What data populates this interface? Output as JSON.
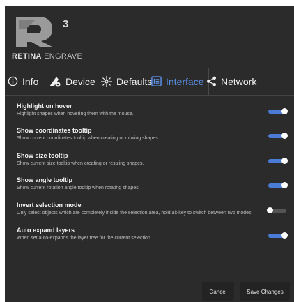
{
  "logo": {
    "superscript": "3",
    "brand_bold": "RETINA",
    "brand_light": "ENGRAVE"
  },
  "tabs": [
    {
      "label": "Info",
      "icon": "info-icon",
      "active": false
    },
    {
      "label": "Device",
      "icon": "device-icon",
      "active": false
    },
    {
      "label": "Defaults",
      "icon": "defaults-icon",
      "active": false
    },
    {
      "label": "Interface",
      "icon": "interface-icon",
      "active": true
    },
    {
      "label": "Network",
      "icon": "share-icon",
      "active": false
    }
  ],
  "settings": [
    {
      "title": "Highlight on hover",
      "description": "Highlight shapes when hovering them with the mouse.",
      "enabled": true
    },
    {
      "title": "Show coordinates tooltip",
      "description": "Show current coordinates tooltip when creating or moving shapes.",
      "enabled": true
    },
    {
      "title": "Show size tooltip",
      "description": "Show current size tooltip when creating or resizing shapes.",
      "enabled": true
    },
    {
      "title": "Show angle tooltip",
      "description": "Show current rotation angle tooltip when rotating shapes.",
      "enabled": true
    },
    {
      "title": "Invert selection mode",
      "description": "Only select objects which are completely inside the selection area, hold alt-key to switch between two modes.",
      "enabled": false
    },
    {
      "title": "Auto expand layers",
      "description": "When set auto-expands the layer tree for the current selection.",
      "enabled": true
    }
  ],
  "buttons": {
    "cancel": "Cancel",
    "save": "Save Changes"
  },
  "colors": {
    "background": "#2b2b2b",
    "accent": "#4a7bd6",
    "active_tab": "#5b8fe6",
    "toggle_off": "#555555"
  }
}
